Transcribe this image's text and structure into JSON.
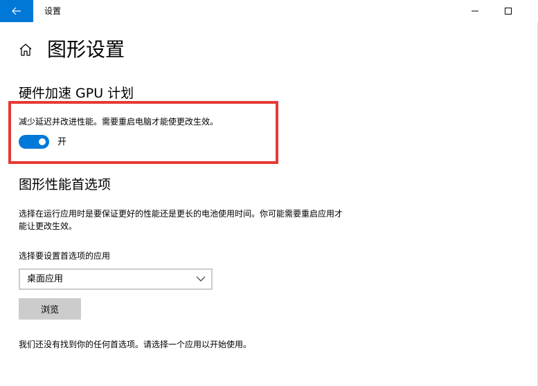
{
  "window": {
    "title": "设置"
  },
  "page": {
    "title": "图形设置"
  },
  "gpu_scheduling": {
    "heading": "硬件加速 GPU 计划",
    "description": "减少延迟并改进性能。需要重启电脑才能使更改生效。",
    "toggle_state_label": "开",
    "toggle_on": true
  },
  "graphics_preference": {
    "heading": "图形性能首选项",
    "description": "选择在运行应用时是要保证更好的性能还是更长的电池使用时间。你可能需要重启应用才能让更改生效。",
    "select_label": "选择要设置首选项的应用",
    "selected_app_type": "桌面应用",
    "browse_label": "浏览",
    "empty_message": "我们还没有找到你的任何首选项。请选择一个应用以开始使用。"
  },
  "colors": {
    "accent": "#0078d7",
    "highlight": "#e53935",
    "button_gray": "#cccccc"
  },
  "icons": {
    "back": "back-arrow-icon",
    "home": "home-icon",
    "minimize": "minimize-icon",
    "maximize": "maximize-icon",
    "close": "close-icon",
    "dropdown": "chevron-down-icon"
  }
}
